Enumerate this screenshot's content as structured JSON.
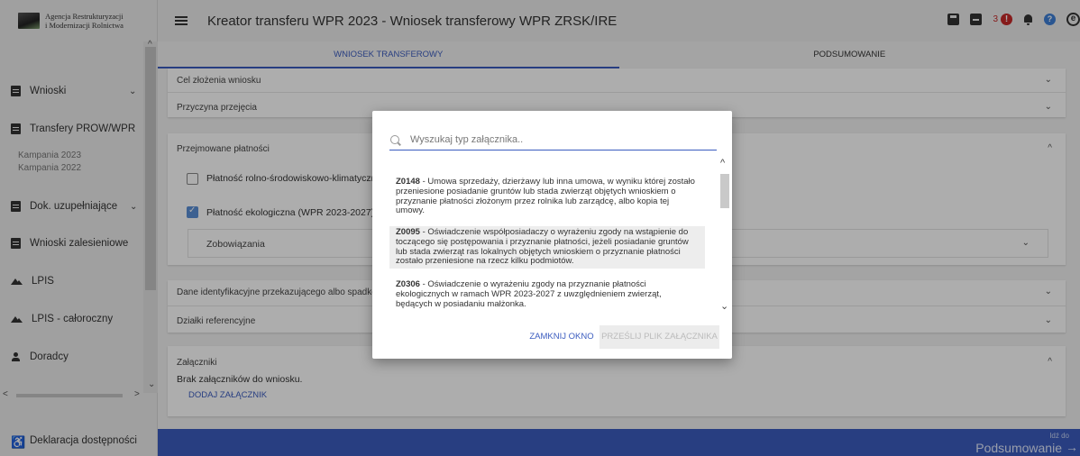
{
  "sidebar": {
    "org_line1": "Agencja Restrukturyzacji",
    "org_line2": "i Modernizacji Rolnictwa",
    "items": [
      {
        "label": "Wnioski",
        "icon": "document-icon"
      },
      {
        "label": "Transfery PROW/WPR",
        "icon": "document-icon"
      },
      {
        "label": "Dok. uzupełniające",
        "icon": "document-icon"
      },
      {
        "label": "Wnioski zalesieniowe",
        "icon": "document-icon"
      },
      {
        "label": "LPIS",
        "icon": "landscape-icon"
      },
      {
        "label": "LPIS - całoroczny",
        "icon": "landscape-icon"
      },
      {
        "label": "Doradcy",
        "icon": "person-icon"
      },
      {
        "label": "Deklaracja dostępności",
        "icon": "accessibility-icon"
      }
    ],
    "sub_items": [
      "Kampania 2023",
      "Kampania 2022"
    ]
  },
  "header": {
    "title": "Kreator transferu WPR 2023 - Wniosek transferowy WPR ZRSK/IRE",
    "notification_count": "3",
    "alert_glyph": "!",
    "help_glyph": "?",
    "user_glyph": "e"
  },
  "tabs": [
    {
      "label": "WNIOSEK TRANSFEROWY",
      "active": true
    },
    {
      "label": "PODSUMOWANIE",
      "active": false
    }
  ],
  "sections": {
    "cel": "Cel złożenia wniosku",
    "przyczyna": "Przyczyna przejęcia",
    "platnosci": "Przejmowane płatności",
    "platnosc1": "Płatność rolno-środowiskowo-klimatyczna",
    "platnosc2": "Płatność ekologiczna (WPR 2023-2027)",
    "zobowiazania": "Zobowiązania",
    "dane": "Dane identyfikacyjne przekazującego albo spadkodawcy",
    "dzialki": "Działki referencyjne",
    "zalaczniki": "Załączniki",
    "brak": "Brak załączników do wniosku.",
    "dodaj": "DODAJ ZAŁĄCZNIK"
  },
  "bottom": {
    "goto_small": "Idź do",
    "goto_big": "Podsumowanie"
  },
  "modal": {
    "search_placeholder": "Wyszukaj typ załącznika..",
    "items": [
      {
        "code": "Z0148",
        "text": " - Umowa sprzedaży, dzierżawy lub inna umowa, w wyniku której zostało przeniesione posiadanie gruntów lub stada zwierząt objętych wnioskiem o przyznanie płatności złożonym przez rolnika lub zarządcę, albo kopia tej umowy."
      },
      {
        "code": "Z0095",
        "text": " - Oświadczenie współposiadaczy o wyrażeniu zgody na wstąpienie do toczącego się postępowania i przyznanie płatności, jeżeli posiadanie gruntów lub stada zwierząt ras lokalnych objętych wnioskiem o przyznanie płatności zostało przeniesione na rzecz kilku podmiotów."
      },
      {
        "code": "Z0306",
        "text": " - Oświadczenie o wyrażeniu zgody na przyznanie płatności ekologicznych w ramach WPR 2023-2027 z uwzględnieniem zwierząt, będących w posiadaniu małżonka."
      }
    ],
    "close_label": "ZAMKNIJ OKNO",
    "upload_label": "PRZEŚLIJ PLIK ZAŁĄCZNIKA"
  },
  "colors": {
    "primary": "#3b5cbf",
    "alert": "#c62828",
    "help": "#3f7fd6",
    "checkbox": "#5b8fd6"
  }
}
